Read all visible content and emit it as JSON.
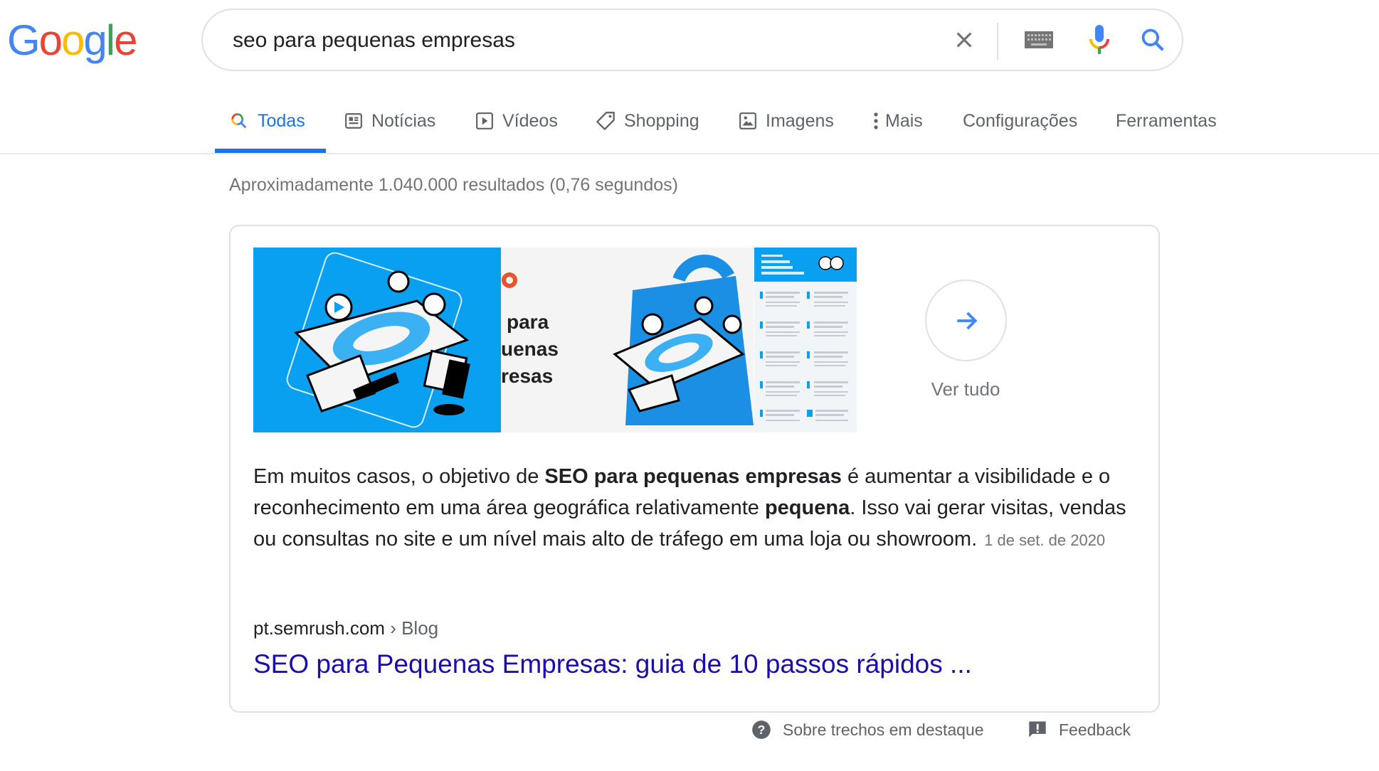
{
  "logo": {
    "letters": [
      {
        "char": "G",
        "color": "#4285f4"
      },
      {
        "char": "o",
        "color": "#ea4335"
      },
      {
        "char": "o",
        "color": "#fbbc05"
      },
      {
        "char": "g",
        "color": "#4285f4"
      },
      {
        "char": "l",
        "color": "#34a853"
      },
      {
        "char": "e",
        "color": "#ea4335"
      }
    ]
  },
  "search": {
    "value": "seo para pequenas empresas",
    "icons": [
      "close-icon",
      "keyboard-icon",
      "microphone-icon",
      "search-icon"
    ]
  },
  "tabs": [
    {
      "label": "Todas",
      "icon": "search-icon",
      "active": true
    },
    {
      "label": "Notícias",
      "icon": "news-icon",
      "active": false
    },
    {
      "label": "Vídeos",
      "icon": "video-icon",
      "active": false
    },
    {
      "label": "Shopping",
      "icon": "tag-icon",
      "active": false
    },
    {
      "label": "Imagens",
      "icon": "image-icon",
      "active": false
    },
    {
      "label": "Mais",
      "icon": "more-vert-icon",
      "active": false
    },
    {
      "label": "Configurações",
      "icon": null,
      "active": false
    },
    {
      "label": "Ferramentas",
      "icon": null,
      "active": false
    }
  ],
  "result_stats": "Aproximadamente 1.040.000 resultados (0,76 segundos)",
  "featured_snippet": {
    "images": [
      {
        "desc": "board game illustration on blue background"
      },
      {
        "desc": "SEO para pequenas empresas banner",
        "text_lines": [
          "para",
          "uenas",
          "resas"
        ]
      },
      {
        "desc": "Checklist de SEO para Pequenas Empresas infographic"
      }
    ],
    "view_all_label": "Ver tudo",
    "snippet_parts": [
      {
        "text": "Em muitos casos, o objetivo de ",
        "bold": false
      },
      {
        "text": "SEO para pequenas empresas",
        "bold": true
      },
      {
        "text": " é aumentar a visibilidade e o reconhecimento em uma área geográfica relativamente ",
        "bold": false
      },
      {
        "text": "pequena",
        "bold": true
      },
      {
        "text": ". Isso vai gerar visitas, vendas ou consultas no site e um nível mais alto de tráfego em uma loja ou showroom.",
        "bold": false
      }
    ],
    "date": "1 de set. de 2020",
    "cite_domain": "pt.semrush.com",
    "cite_separator": "›",
    "cite_path": "Blog",
    "title": "SEO para Pequenas Empresas: guia de 10 passos rápidos ..."
  },
  "footer": {
    "about_label": "Sobre trechos em destaque",
    "feedback_label": "Feedback"
  },
  "colors": {
    "accent": "#1a73e8",
    "link": "#1a0dab",
    "muted": "#70757a",
    "image_blue": "#0aa0f2"
  }
}
